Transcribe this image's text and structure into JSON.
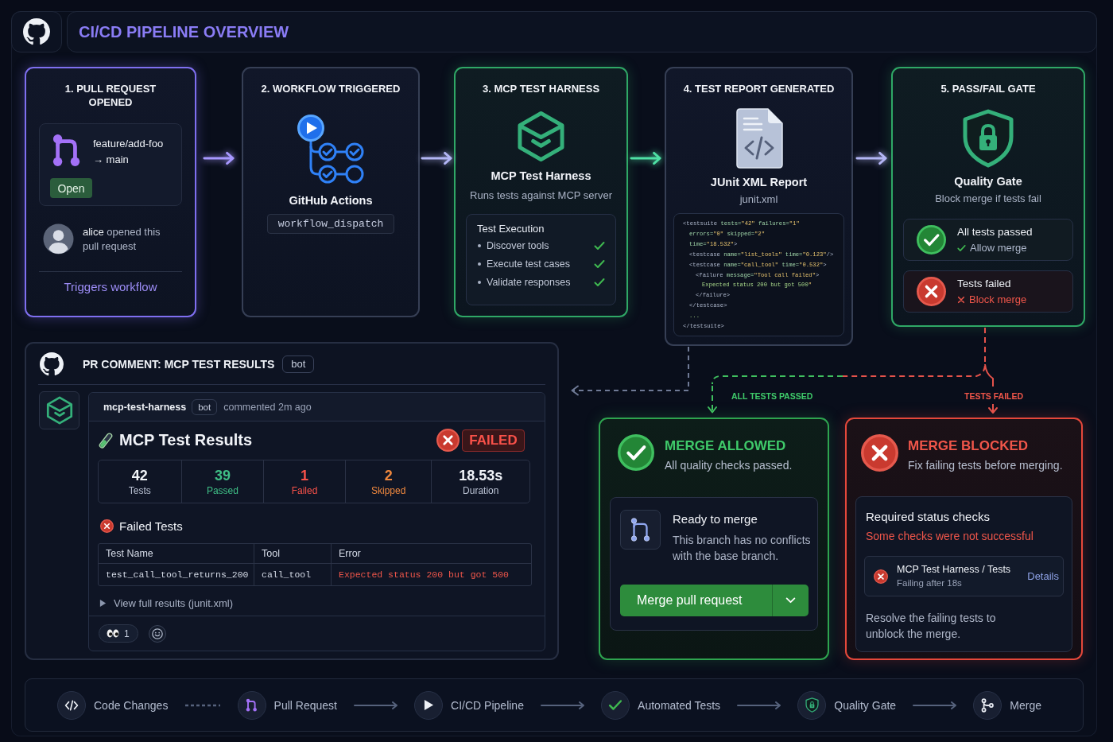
{
  "header": {
    "title": "CI/CD PIPELINE OVERVIEW"
  },
  "steps": [
    {
      "kind": "pull_request",
      "title": "1. PULL REQUEST OPENED",
      "branch": "feature/add-foo",
      "target": "→ main",
      "state": "Open",
      "author": "**alice** opened this pull request",
      "action": "Triggers workflow"
    },
    {
      "kind": "workflow",
      "title": "2. WORKFLOW TRIGGERED",
      "name": "GitHub Actions",
      "event": "workflow_dispatch"
    },
    {
      "kind": "harness",
      "title": "3. MCP TEST HARNESS",
      "name": "MCP Test Harness",
      "subtitle": "Runs tests against MCP server",
      "panel_title": "Test Execution",
      "tasks": [
        {
          "label": "Discover tools",
          "checked": true
        },
        {
          "label": "Execute test cases",
          "checked": true
        },
        {
          "label": "Validate responses",
          "checked": true
        }
      ]
    },
    {
      "kind": "report",
      "title": "4. TEST REPORT GENERATED",
      "name": "JUnit XML Report",
      "file": "junit.xml",
      "code": [
        {
          "text": "<testsuite tests=\"42\" failures=\"1\"",
          "children": [
            {
              "text": "errors=\"0\" skipped=\"2\""
            },
            {
              "text": "time=\"18.532\">"
            },
            {
              "text": "<testcase name=\"list_tools\" time=\"0.123\"/>"
            },
            {
              "text": "<testcase name=\"call_tool\" time=\"0.532\">",
              "children": [
                {
                  "text": "<failure message=\"Tool call failed\">",
                  "children": [
                    {
                      "text": "Expected status 200 but got 500\""
                    }
                  ]
                },
                {
                  "text": "</failure>"
                }
              ]
            },
            {
              "text": "</testcase>"
            },
            {
              "text": "..."
            }
          ]
        },
        {
          "text": "</testsuite>"
        }
      ]
    },
    {
      "kind": "gate",
      "title": "5. PASS/FAIL GATE",
      "name": "Quality Gate",
      "subtitle": "Block merge if tests fail",
      "results": [
        {
          "kind": "pass",
          "title": "All tests passed",
          "action": "Allow merge"
        },
        {
          "kind": "fail",
          "title": "Tests failed",
          "action": "Block merge"
        }
      ]
    }
  ],
  "pr_comment": {
    "title": "PR COMMENT: MCP TEST RESULTS",
    "badge": "bot",
    "comment": {
      "author": "mcp-test-harness",
      "author_badge": "bot",
      "meta": "commented 2m ago",
      "heading": "MCP Test Results",
      "status": "FAILED",
      "stats": [
        {
          "kind": "neutral",
          "value": "42",
          "label": "Tests"
        },
        {
          "kind": "pass",
          "value": "39",
          "label": "Passed"
        },
        {
          "kind": "fail",
          "value": "1",
          "label": "Failed"
        },
        {
          "kind": "skip",
          "value": "2",
          "label": "Skipped"
        },
        {
          "kind": "neutral",
          "value": "18.53s",
          "label": "Duration"
        }
      ],
      "failed_title": "Failed Tests",
      "table": {
        "columns": [
          "Test Name",
          "Tool",
          "Error"
        ],
        "rows": [
          [
            "test_call_tool_returns_200",
            "call_tool",
            "Expected status 200 but got 500"
          ]
        ]
      },
      "details": {
        "label": "View full results (junit.xml)",
        "expanded": false
      },
      "reactions": [
        {
          "count": "1"
        }
      ]
    }
  },
  "outcomes": [
    {
      "kind": "allowed",
      "label": "ALL TESTS PASSED",
      "title": "MERGE ALLOWED",
      "subtitle": "All quality checks passed.",
      "panel": {
        "title": "Ready to merge",
        "text": "This branch has no conflicts with the base branch.",
        "button": "Merge pull request"
      }
    },
    {
      "kind": "blocked",
      "label": "TESTS FAILED",
      "title": "MERGE BLOCKED",
      "subtitle": "Fix failing tests before merging.",
      "panel": {
        "title": "Required status checks",
        "text": "Some checks were not successful",
        "check": {
          "name": "MCP Test Harness / Tests",
          "meta": "Failing after 18s",
          "link": "Details"
        },
        "note": "Resolve the failing tests to unblock the merge."
      }
    }
  ],
  "flow": {
    "steps": [
      {
        "kind": "code",
        "label": "Code Changes"
      },
      {
        "kind": "pull_request",
        "label": "Pull Request"
      },
      {
        "kind": "pipeline",
        "label": "CI/CD Pipeline"
      },
      {
        "kind": "tests",
        "label": "Automated Tests"
      },
      {
        "kind": "gate",
        "label": "Quality Gate"
      },
      {
        "kind": "merge",
        "label": "Merge"
      }
    ],
    "links": [
      {
        "dashed": true
      },
      {
        "dashed": false
      },
      {
        "dashed": false
      },
      {
        "dashed": false
      },
      {
        "dashed": false
      }
    ]
  }
}
